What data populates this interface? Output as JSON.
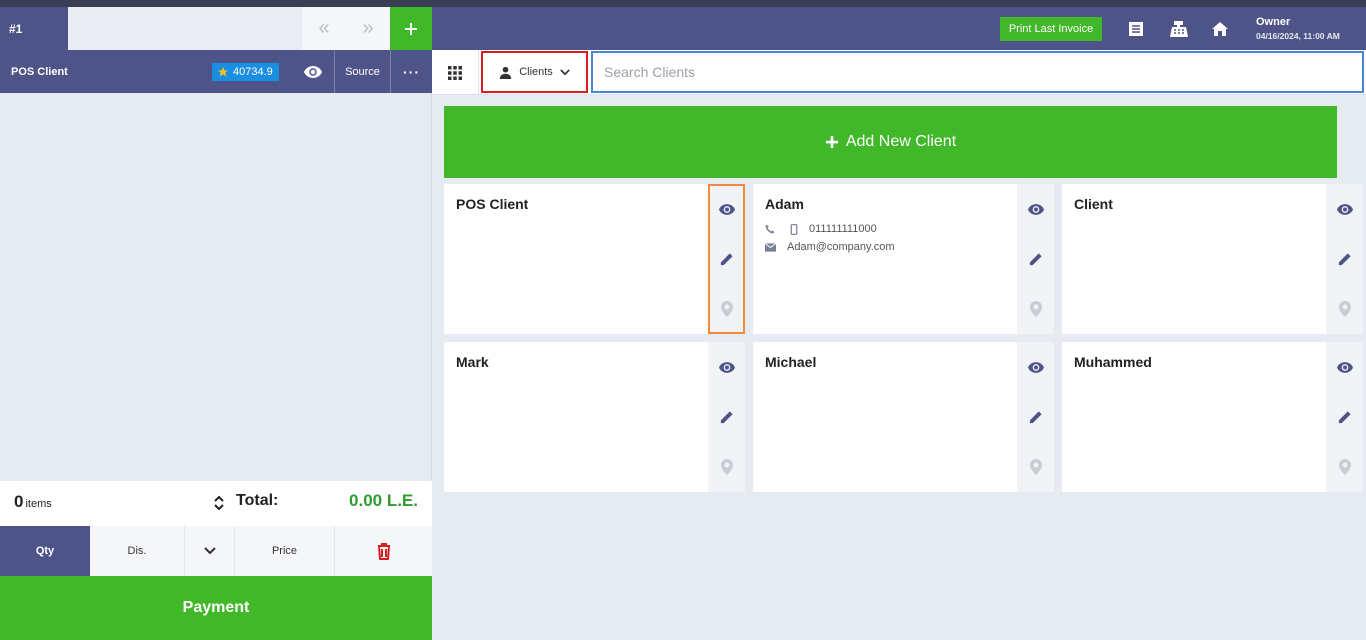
{
  "invoice_tab": {
    "label": "#1"
  },
  "left": {
    "client_name": "POS Client",
    "points": "40734.9",
    "source_label": "Source",
    "more_label": "···",
    "items_count": "0",
    "items_label": "items",
    "total_label": "Total:",
    "total_value": "0.00 L.E.",
    "actions": {
      "qty": "Qty",
      "dis": "Dis.",
      "price": "Price"
    },
    "payment_label": "Payment"
  },
  "header": {
    "print_label": "Print Last Invoice",
    "user_name": "Owner",
    "user_date": "04/16/2024, 11:00 AM"
  },
  "search": {
    "type_label": "Clients",
    "placeholder": "Search Clients"
  },
  "add_client_label": "Add New Client",
  "clients": [
    {
      "name": "POS Client",
      "phone": "",
      "email": ""
    },
    {
      "name": "Adam",
      "phone": "011111111000",
      "email": "Adam@company.com"
    },
    {
      "name": "Client",
      "phone": "",
      "email": ""
    },
    {
      "name": "Mark",
      "phone": "",
      "email": ""
    },
    {
      "name": "Michael",
      "phone": "",
      "email": ""
    },
    {
      "name": "Muhammed",
      "phone": "",
      "email": ""
    }
  ],
  "colors": {
    "primary": "#4f5488",
    "accent_green": "#41b82a",
    "points_blue": "#1a8ee0",
    "total_green": "#2e9c2e",
    "delete_red": "#d62020",
    "select_border_red": "#d62020",
    "search_border_blue": "#4a86d8",
    "highlight_orange": "#f28a3c"
  },
  "icons": [
    "plus-icon",
    "chevrons-left-icon",
    "chevrons-right-icon",
    "star-icon",
    "eye-icon",
    "sort-icon",
    "chevron-down-icon",
    "trash-icon",
    "invoice-icon",
    "cash-register-icon",
    "home-icon",
    "grid-icon",
    "user-icon",
    "phone-icon",
    "mobile-icon",
    "mail-icon",
    "pencil-icon",
    "location-icon"
  ]
}
